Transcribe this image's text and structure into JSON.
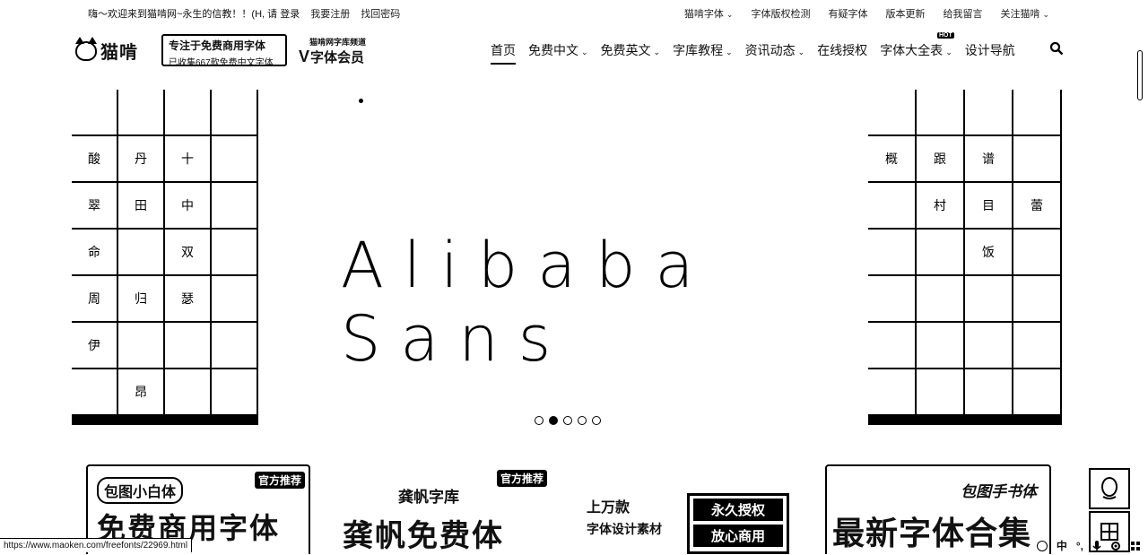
{
  "topbar": {
    "greeting": "嗨～欢迎来到猫啃网~永生的信教！！(H, 请 登录",
    "login": "我要注册",
    "register": "找回密码",
    "right_items": [
      {
        "label": "猫啃字体",
        "caret": true
      },
      {
        "label": "字体版权检测",
        "caret": false
      },
      {
        "label": "有疑字体",
        "caret": false
      },
      {
        "label": "版本更新",
        "caret": false
      },
      {
        "label": "给我留言",
        "caret": false
      },
      {
        "label": "关注猫啃",
        "caret": true
      }
    ]
  },
  "header": {
    "logo_name": "猫啃",
    "slogan_line1": "专注于免费商用字体",
    "slogan_line2": "已收集667款免费中文字体",
    "vip_line1": "猫啃网字库频道",
    "vip_v": "V",
    "vip_line2": "字体会员",
    "nav": [
      {
        "label": "首页",
        "active": true,
        "caret": false,
        "hot": false
      },
      {
        "label": "免费中文",
        "active": false,
        "caret": true,
        "hot": false
      },
      {
        "label": "免费英文",
        "active": false,
        "caret": true,
        "hot": false
      },
      {
        "label": "字库教程",
        "active": false,
        "caret": true,
        "hot": false
      },
      {
        "label": "资讯动态",
        "active": false,
        "caret": true,
        "hot": false
      },
      {
        "label": "在线授权",
        "active": false,
        "caret": false,
        "hot": false
      },
      {
        "label": "字体大全表",
        "active": false,
        "caret": true,
        "hot": true
      },
      {
        "label": "设计导航",
        "active": false,
        "caret": false,
        "hot": false
      }
    ],
    "hot_label": "HOT"
  },
  "banner": {
    "title": "Alibaba Sans",
    "left_cells": [
      "",
      "",
      "",
      "",
      "酸",
      "丹",
      "十",
      "",
      "翠",
      "田",
      "中",
      "",
      "命",
      "",
      "双",
      "",
      "周",
      "归",
      "瑟",
      "",
      "伊",
      "",
      "",
      "",
      "",
      "昂",
      "",
      "",
      "",
      "",
      "",
      "",
      "",
      "",
      "",
      "",
      "",
      "",
      "",
      "",
      "",
      "",
      "",
      "",
      "",
      "",
      "",
      ""
    ],
    "right_cells": [
      "",
      "",
      "",
      "",
      "概",
      "跟",
      "谱",
      "",
      "",
      "村",
      "目",
      "蕾",
      "",
      "",
      "饭",
      "",
      "",
      "",
      "",
      "",
      "",
      "",
      "",
      "",
      "",
      "",
      "",
      "",
      "",
      "",
      "",
      "",
      "",
      "",
      "",
      "",
      "",
      "",
      "",
      "",
      "",
      "",
      "",
      "",
      "",
      "",
      "",
      ""
    ],
    "dots": [
      false,
      true,
      false,
      false,
      false
    ]
  },
  "ads": {
    "ad1_tag": "官方推荐",
    "ad1_title": "包图小白体",
    "ad1_sub": "免费商用字体",
    "ad2_tag": "官方推荐",
    "ad2_title": "龚帆字库",
    "ad2_sub": "龚帆免费体",
    "ad3_line1": "上万款",
    "ad3_line2": "字体设计素材",
    "ad3_box1": "永久授权",
    "ad3_box2": "放心商用",
    "ad4_title": "包图手书体",
    "ad4_sub": "最新字体合集"
  },
  "status": {
    "url": "https://www.maoken.com/freefonts/22969.html"
  },
  "tray": {
    "ime": "中",
    "punct": "°,"
  }
}
